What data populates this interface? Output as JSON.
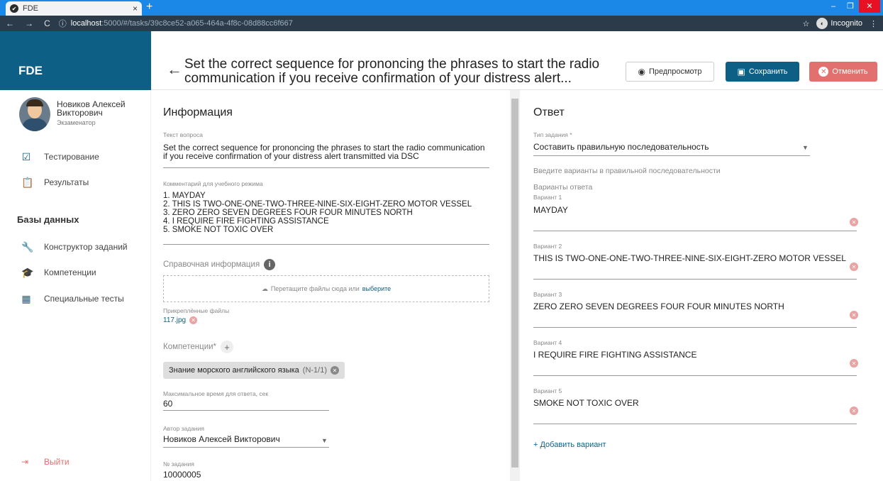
{
  "browser": {
    "tab_title": "FDE",
    "tab_close": "×",
    "new_tab": "+",
    "url_host": "localhost",
    "url_path": ":5000/#/tasks/39c8ce52-a065-464a-4f8c-08d88cc6f667",
    "incognito_label": "Incognito"
  },
  "app": {
    "logo": "FDE"
  },
  "header": {
    "title": "Set the correct sequence for prononcing the phrases to start the radio communication if you receive confirmation of your distress alert...",
    "preview_label": "Предпросмотр",
    "save_label": "Сохранить",
    "cancel_label": "Отменить"
  },
  "sidebar": {
    "user_name": "Новиков Алексей Викторович",
    "user_role": "Экзаменатор",
    "items": [
      {
        "label": "Тестирование",
        "icon": "checkbox-icon"
      },
      {
        "label": "Результаты",
        "icon": "clipboard-icon"
      }
    ],
    "section_title": "Базы данных",
    "db_items": [
      {
        "label": "Конструктор заданий",
        "icon": "wrench-icon"
      },
      {
        "label": "Компетенции",
        "icon": "graduation-cap-icon"
      },
      {
        "label": "Специальные тесты",
        "icon": "table-icon"
      }
    ],
    "logout_label": "Выйти"
  },
  "info": {
    "title": "Информация",
    "question_label": "Текст вопроса",
    "question_text": "Set the correct sequence for prononcing the phrases to start the radio communication if you receive confirmation of your distress alert transmitted via DSC",
    "comment_label": "Комментарий для учебного режима",
    "comment_lines": [
      "1. MAYDAY",
      "2. THIS IS TWO-ONE-ONE-TWO-THREE-NINE-SIX-EIGHT-ZERO MOTOR VESSEL",
      "3. ZERO ZERO SEVEN DEGREES FOUR FOUR MINUTES NORTH",
      "4. I REQUIRE FIRE FIGHTING ASSISTANCE",
      "5. SMOKE NOT TOXIC OVER"
    ],
    "reference_label": "Справочная информация",
    "dropzone_text": "Перетащите файлы сюда или",
    "dropzone_link": "выберите",
    "attached_label": "Прикреплённые файлы",
    "attached_file": "117.jpg",
    "competencies_label": "Компетенции*",
    "chip_label": "Знание морского английского языка",
    "chip_code": "(N-1/1)",
    "max_time_label": "Максимальное время для ответа, сек",
    "max_time_value": "60",
    "author_label": "Автор задания",
    "author_value": "Новиков Алексей Викторович",
    "task_number_label": "№ задания",
    "task_number_value": "10000005"
  },
  "answer": {
    "title": "Ответ",
    "type_label": "Тип задания *",
    "type_value": "Составить правильную последовательность",
    "hint": "Введите варианты в правильной последовательности",
    "variants_label": "Варианты ответа",
    "variants": [
      {
        "label": "Вариант 1",
        "value": "MAYDAY"
      },
      {
        "label": "Вариант 2",
        "value": "THIS IS TWO-ONE-ONE-TWO-THREE-NINE-SIX-EIGHT-ZERO MOTOR VESSEL"
      },
      {
        "label": "Вариант 3",
        "value": "ZERO ZERO SEVEN DEGREES FOUR FOUR MINUTES NORTH"
      },
      {
        "label": "Вариант 4",
        "value": "I REQUIRE FIRE FIGHTING ASSISTANCE"
      },
      {
        "label": "Вариант 5",
        "value": "SMOKE NOT TOXIC OVER"
      }
    ],
    "add_variant_label": "+ Добавить вариант"
  },
  "colors": {
    "primary": "#0d5f86",
    "danger": "#e2706f",
    "browser_tabbar": "#1b87e6"
  }
}
